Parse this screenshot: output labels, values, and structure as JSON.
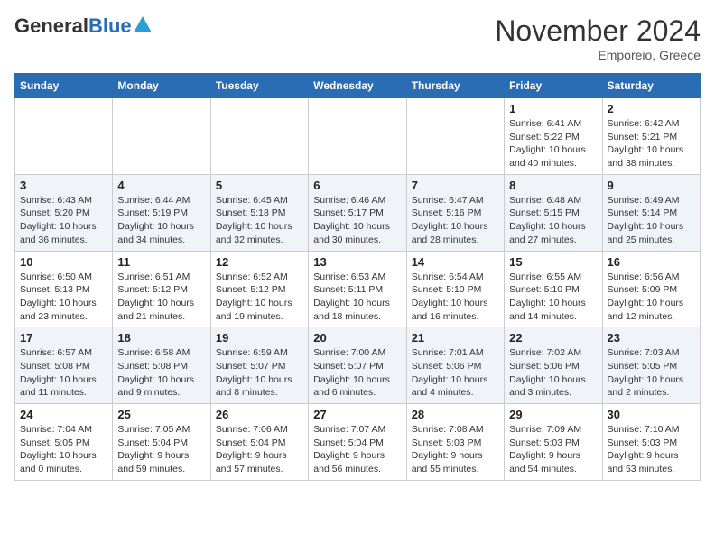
{
  "header": {
    "logo_general": "General",
    "logo_blue": "Blue",
    "month": "November 2024",
    "location": "Emporeio, Greece"
  },
  "weekdays": [
    "Sunday",
    "Monday",
    "Tuesday",
    "Wednesday",
    "Thursday",
    "Friday",
    "Saturday"
  ],
  "weeks": [
    [
      {
        "day": "",
        "info": ""
      },
      {
        "day": "",
        "info": ""
      },
      {
        "day": "",
        "info": ""
      },
      {
        "day": "",
        "info": ""
      },
      {
        "day": "",
        "info": ""
      },
      {
        "day": "1",
        "info": "Sunrise: 6:41 AM\nSunset: 5:22 PM\nDaylight: 10 hours and 40 minutes."
      },
      {
        "day": "2",
        "info": "Sunrise: 6:42 AM\nSunset: 5:21 PM\nDaylight: 10 hours and 38 minutes."
      }
    ],
    [
      {
        "day": "3",
        "info": "Sunrise: 6:43 AM\nSunset: 5:20 PM\nDaylight: 10 hours and 36 minutes."
      },
      {
        "day": "4",
        "info": "Sunrise: 6:44 AM\nSunset: 5:19 PM\nDaylight: 10 hours and 34 minutes."
      },
      {
        "day": "5",
        "info": "Sunrise: 6:45 AM\nSunset: 5:18 PM\nDaylight: 10 hours and 32 minutes."
      },
      {
        "day": "6",
        "info": "Sunrise: 6:46 AM\nSunset: 5:17 PM\nDaylight: 10 hours and 30 minutes."
      },
      {
        "day": "7",
        "info": "Sunrise: 6:47 AM\nSunset: 5:16 PM\nDaylight: 10 hours and 28 minutes."
      },
      {
        "day": "8",
        "info": "Sunrise: 6:48 AM\nSunset: 5:15 PM\nDaylight: 10 hours and 27 minutes."
      },
      {
        "day": "9",
        "info": "Sunrise: 6:49 AM\nSunset: 5:14 PM\nDaylight: 10 hours and 25 minutes."
      }
    ],
    [
      {
        "day": "10",
        "info": "Sunrise: 6:50 AM\nSunset: 5:13 PM\nDaylight: 10 hours and 23 minutes."
      },
      {
        "day": "11",
        "info": "Sunrise: 6:51 AM\nSunset: 5:12 PM\nDaylight: 10 hours and 21 minutes."
      },
      {
        "day": "12",
        "info": "Sunrise: 6:52 AM\nSunset: 5:12 PM\nDaylight: 10 hours and 19 minutes."
      },
      {
        "day": "13",
        "info": "Sunrise: 6:53 AM\nSunset: 5:11 PM\nDaylight: 10 hours and 18 minutes."
      },
      {
        "day": "14",
        "info": "Sunrise: 6:54 AM\nSunset: 5:10 PM\nDaylight: 10 hours and 16 minutes."
      },
      {
        "day": "15",
        "info": "Sunrise: 6:55 AM\nSunset: 5:10 PM\nDaylight: 10 hours and 14 minutes."
      },
      {
        "day": "16",
        "info": "Sunrise: 6:56 AM\nSunset: 5:09 PM\nDaylight: 10 hours and 12 minutes."
      }
    ],
    [
      {
        "day": "17",
        "info": "Sunrise: 6:57 AM\nSunset: 5:08 PM\nDaylight: 10 hours and 11 minutes."
      },
      {
        "day": "18",
        "info": "Sunrise: 6:58 AM\nSunset: 5:08 PM\nDaylight: 10 hours and 9 minutes."
      },
      {
        "day": "19",
        "info": "Sunrise: 6:59 AM\nSunset: 5:07 PM\nDaylight: 10 hours and 8 minutes."
      },
      {
        "day": "20",
        "info": "Sunrise: 7:00 AM\nSunset: 5:07 PM\nDaylight: 10 hours and 6 minutes."
      },
      {
        "day": "21",
        "info": "Sunrise: 7:01 AM\nSunset: 5:06 PM\nDaylight: 10 hours and 4 minutes."
      },
      {
        "day": "22",
        "info": "Sunrise: 7:02 AM\nSunset: 5:06 PM\nDaylight: 10 hours and 3 minutes."
      },
      {
        "day": "23",
        "info": "Sunrise: 7:03 AM\nSunset: 5:05 PM\nDaylight: 10 hours and 2 minutes."
      }
    ],
    [
      {
        "day": "24",
        "info": "Sunrise: 7:04 AM\nSunset: 5:05 PM\nDaylight: 10 hours and 0 minutes."
      },
      {
        "day": "25",
        "info": "Sunrise: 7:05 AM\nSunset: 5:04 PM\nDaylight: 9 hours and 59 minutes."
      },
      {
        "day": "26",
        "info": "Sunrise: 7:06 AM\nSunset: 5:04 PM\nDaylight: 9 hours and 57 minutes."
      },
      {
        "day": "27",
        "info": "Sunrise: 7:07 AM\nSunset: 5:04 PM\nDaylight: 9 hours and 56 minutes."
      },
      {
        "day": "28",
        "info": "Sunrise: 7:08 AM\nSunset: 5:03 PM\nDaylight: 9 hours and 55 minutes."
      },
      {
        "day": "29",
        "info": "Sunrise: 7:09 AM\nSunset: 5:03 PM\nDaylight: 9 hours and 54 minutes."
      },
      {
        "day": "30",
        "info": "Sunrise: 7:10 AM\nSunset: 5:03 PM\nDaylight: 9 hours and 53 minutes."
      }
    ]
  ]
}
